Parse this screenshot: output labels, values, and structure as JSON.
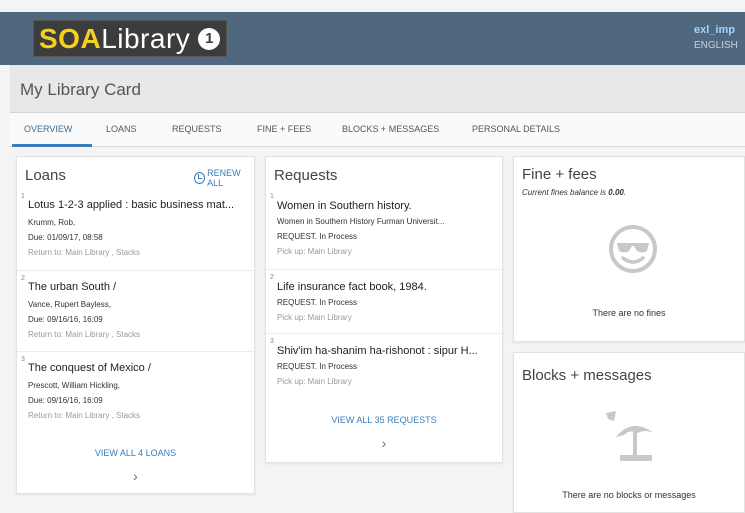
{
  "header": {
    "logo_soa": "SOA",
    "logo_library": "Library",
    "logo_number": "1",
    "user": "exl_imp",
    "language": "ENGLISH"
  },
  "page": {
    "title": "My Library Card"
  },
  "tabs": [
    {
      "label": "OVERVIEW",
      "active": true
    },
    {
      "label": "LOANS"
    },
    {
      "label": "REQUESTS"
    },
    {
      "label": "FINE + FEES"
    },
    {
      "label": "BLOCKS + MESSAGES"
    },
    {
      "label": "PERSONAL DETAILS"
    }
  ],
  "loans": {
    "title": "Loans",
    "renew_all": "RENEW ALL",
    "items": [
      {
        "index": "1",
        "title": "Lotus 1-2-3 applied : basic business mat...",
        "author": "Krumm, Rob,",
        "due": "Due: 01/09/17, 08:58",
        "return_to": "Return to: Main Library , Stacks"
      },
      {
        "index": "2",
        "title": "The urban South /",
        "author": "Vance, Rupert Bayless,",
        "due": "Due: 09/16/16, 16:09",
        "return_to": "Return to: Main Library , Stacks"
      },
      {
        "index": "3",
        "title": "The conquest of Mexico /",
        "author": "Prescott, William Hickling,",
        "due": "Due: 09/16/16, 16:09",
        "return_to": "Return to: Main Library , Stacks"
      }
    ],
    "view_all": "VIEW ALL 4 LOANS",
    "chevron": "›"
  },
  "requests": {
    "title": "Requests",
    "items": [
      {
        "index": "1",
        "title": "Women in Southern history.",
        "detail": "Women in Southern History Furman Universit...",
        "status": "REQUEST. In Process",
        "pickup": "Pick up: Main Library"
      },
      {
        "index": "2",
        "title": "Life insurance fact book, 1984.",
        "status": "REQUEST. In Process",
        "pickup": "Pick up: Main Library"
      },
      {
        "index": "3",
        "title": "Shiv'im ha-shanim ha-rishonot : sipur H...",
        "status": "REQUEST. In Process",
        "pickup": "Pick up: Main Library"
      }
    ],
    "view_all": "VIEW ALL 35 REQUESTS",
    "chevron": "›"
  },
  "fines": {
    "title": "Fine + fees",
    "balance_prefix": "Current fines balance is",
    "balance_value": "0.00",
    "balance_suffix": ".",
    "icon": "sunglasses-smiley-icon",
    "message": "There are no fines"
  },
  "blocks": {
    "title": "Blocks + messages",
    "icon": "beach-umbrella-icon",
    "message": "There are no blocks or messages"
  },
  "colors": {
    "header_bg": "#50687e",
    "accent": "#3a7db8",
    "logo_yellow": "#f5d21a"
  }
}
